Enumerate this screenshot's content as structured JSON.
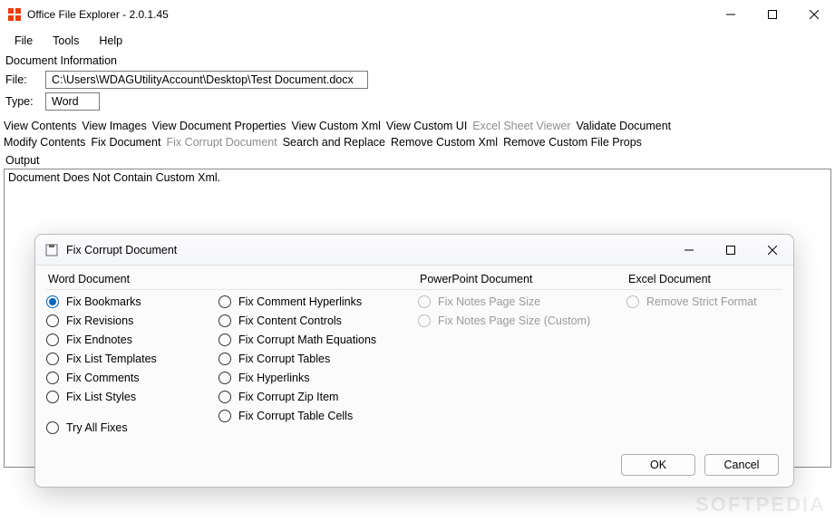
{
  "window": {
    "title": "Office File Explorer - 2.0.1.45"
  },
  "menu": {
    "file": "File",
    "tools": "Tools",
    "help": "Help"
  },
  "doc_info": {
    "section_label": "Document Information",
    "file_label": "File:",
    "file_value": "C:\\Users\\WDAGUtilityAccount\\Desktop\\Test Document.docx",
    "type_label": "Type:",
    "type_value": "Word"
  },
  "toolbar_row1": {
    "view_contents": "View Contents",
    "view_images": "View Images",
    "view_doc_props": "View Document Properties",
    "view_custom_xml": "View Custom Xml",
    "view_custom_ui": "View Custom UI",
    "excel_sheet_viewer": "Excel Sheet Viewer",
    "validate_document": "Validate Document"
  },
  "toolbar_row2": {
    "modify_contents": "Modify Contents",
    "fix_document": "Fix Document",
    "fix_corrupt_document": "Fix Corrupt Document",
    "search_replace": "Search and Replace",
    "remove_custom_xml": "Remove Custom Xml",
    "remove_custom_file_props": "Remove Custom File Props"
  },
  "output": {
    "label": "Output",
    "text": "Document Does Not Contain Custom Xml."
  },
  "dialog": {
    "title": "Fix Corrupt Document",
    "groups": {
      "word": {
        "title": "Word Document",
        "col1": {
          "fix_bookmarks": "Fix Bookmarks",
          "fix_revisions": "Fix Revisions",
          "fix_endnotes": "Fix Endnotes",
          "fix_list_templates": "Fix List Templates",
          "fix_comments": "Fix Comments",
          "fix_list_styles": "Fix List Styles",
          "try_all_fixes": "Try All Fixes"
        },
        "col2": {
          "fix_comment_hyperlinks": "Fix Comment Hyperlinks",
          "fix_content_controls": "Fix Content Controls",
          "fix_corrupt_math": "Fix Corrupt Math Equations",
          "fix_corrupt_tables": "Fix Corrupt Tables",
          "fix_hyperlinks": "Fix Hyperlinks",
          "fix_corrupt_zip": "Fix Corrupt Zip Item",
          "fix_corrupt_table_cells": "Fix Corrupt Table Cells"
        }
      },
      "ppt": {
        "title": "PowerPoint Document",
        "fix_notes_page_size": "Fix Notes Page Size",
        "fix_notes_page_size_custom": "Fix Notes Page Size (Custom)"
      },
      "excel": {
        "title": "Excel Document",
        "remove_strict_format": "Remove Strict Format"
      }
    },
    "buttons": {
      "ok": "OK",
      "cancel": "Cancel"
    }
  },
  "watermark": "SOFTPEDIA"
}
